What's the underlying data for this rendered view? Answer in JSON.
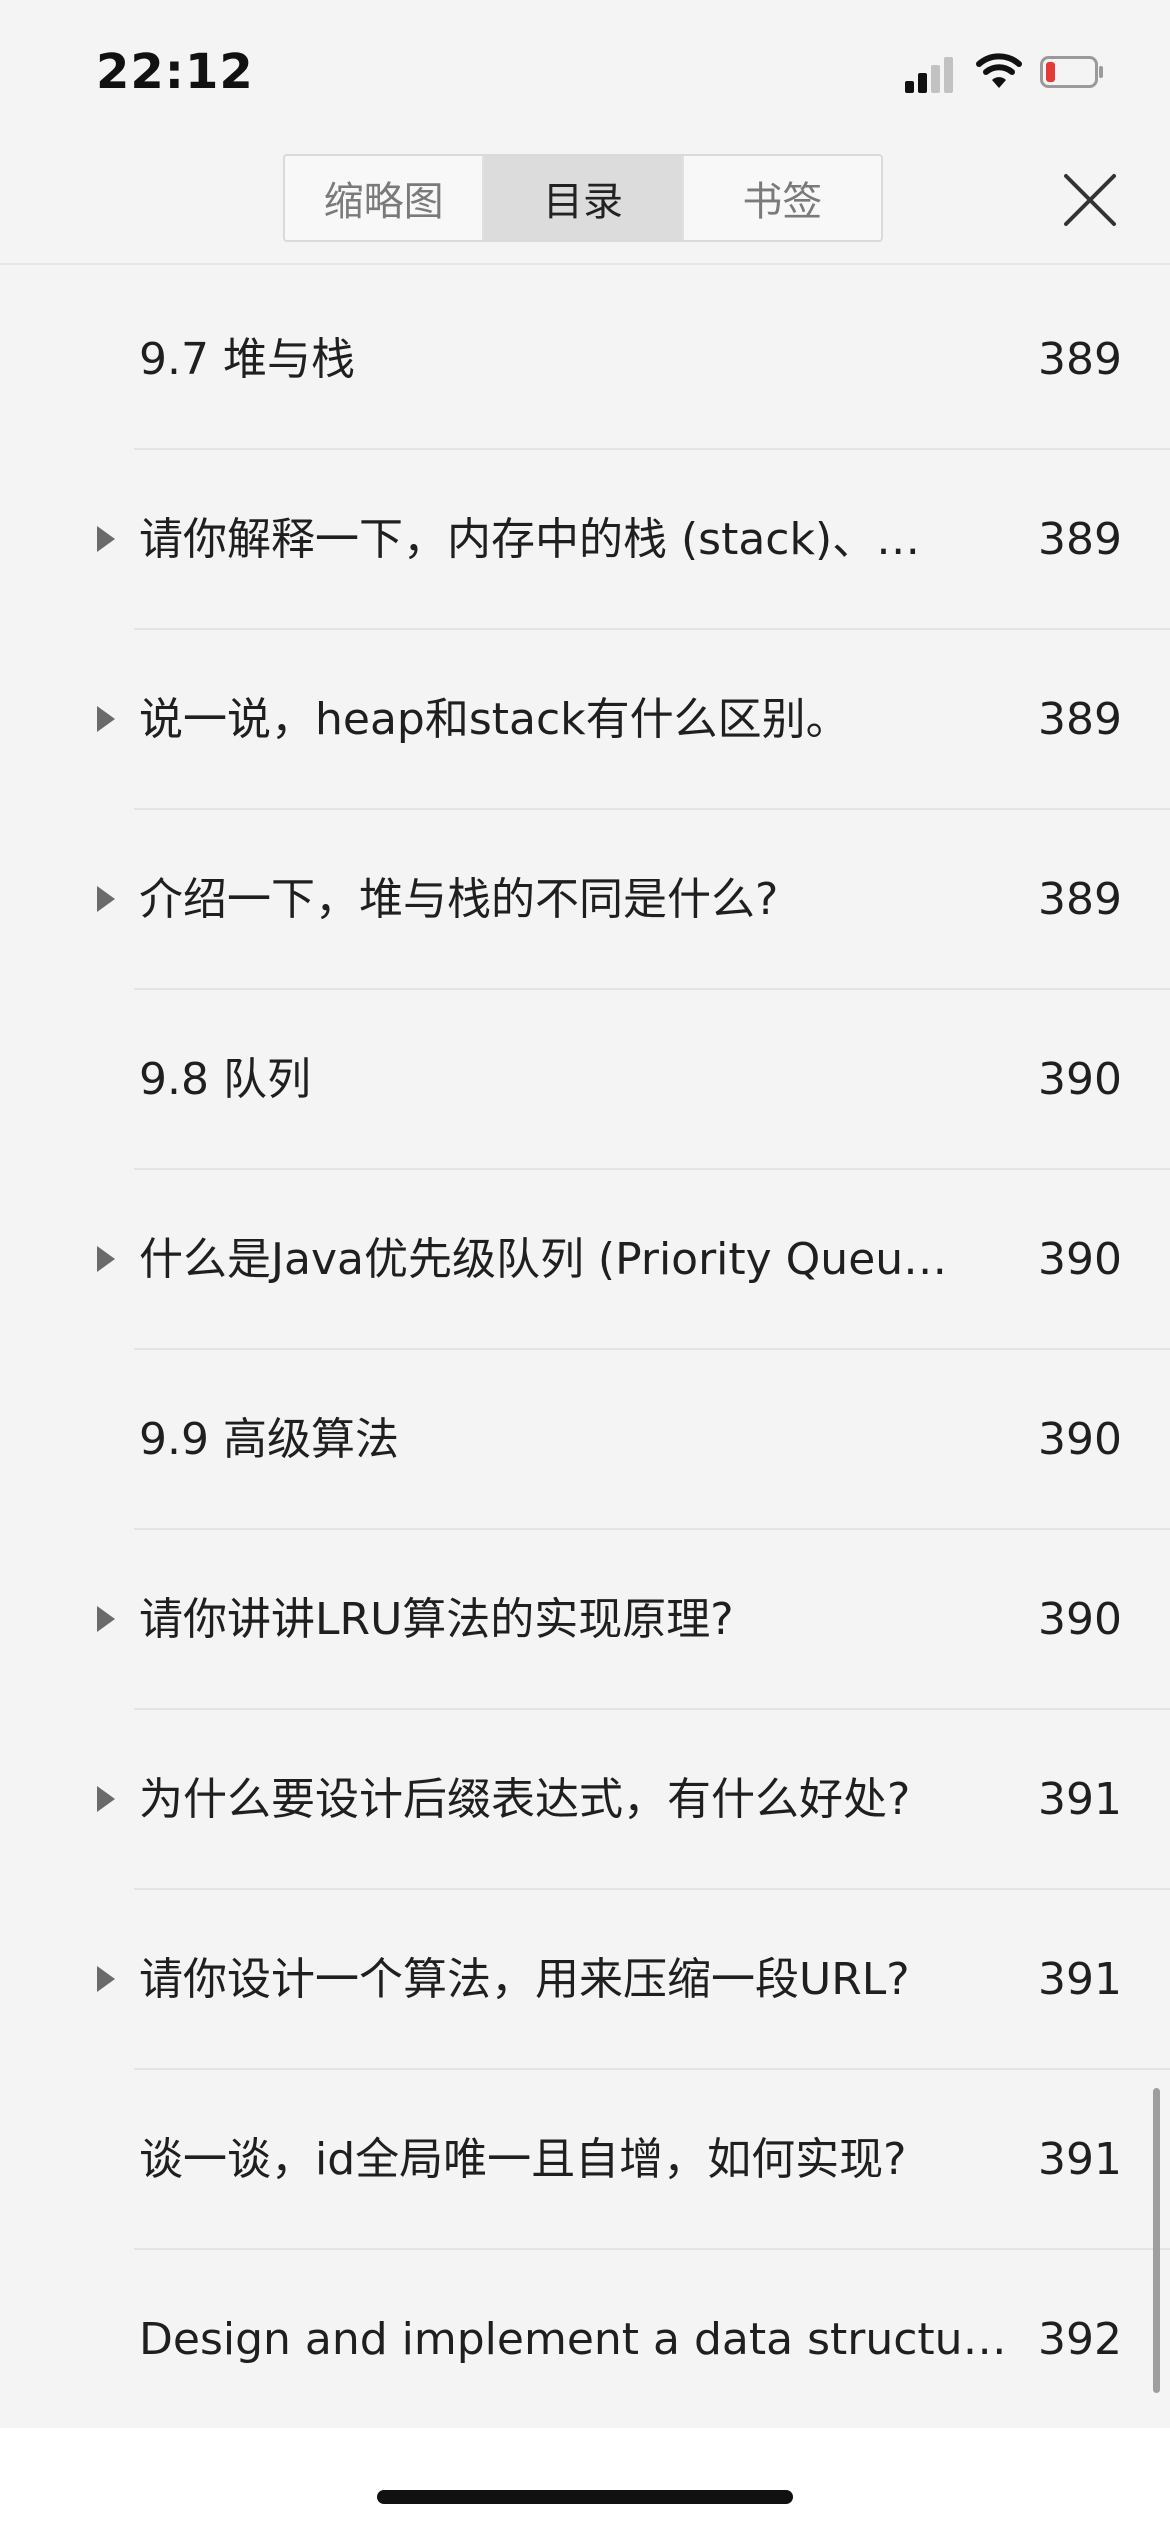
{
  "status_bar": {
    "time": "22:12"
  },
  "tabs": [
    {
      "label": "缩略图",
      "active": false
    },
    {
      "label": "目录",
      "active": true
    },
    {
      "label": "书签",
      "active": false
    }
  ],
  "toc": [
    {
      "title": "9.7 堆与栈",
      "page": "389",
      "expandable": false
    },
    {
      "title": "请你解释一下，内存中的栈 (stack)、…",
      "page": "389",
      "expandable": true
    },
    {
      "title": "说一说，heap和stack有什么区别。",
      "page": "389",
      "expandable": true
    },
    {
      "title": "介绍一下，堆与栈的不同是什么?",
      "page": "389",
      "expandable": true
    },
    {
      "title": "9.8 队列",
      "page": "390",
      "expandable": false
    },
    {
      "title": "什么是Java优先级队列 (Priority Queu…",
      "page": "390",
      "expandable": true
    },
    {
      "title": "9.9  高级算法",
      "page": "390",
      "expandable": false
    },
    {
      "title": "请你讲讲LRU算法的实现原理?",
      "page": "390",
      "expandable": true
    },
    {
      "title": "为什么要设计后缀表达式，有什么好处?",
      "page": "391",
      "expandable": true
    },
    {
      "title": "请你设计一个算法，用来压缩一段URL?",
      "page": "391",
      "expandable": true
    },
    {
      "title": "谈一谈，id全局唯一且自增，如何实现?",
      "page": "391",
      "expandable": false
    },
    {
      "title": "Design and implement a data structure…",
      "page": "392",
      "expandable": false
    }
  ],
  "icons": {
    "close": "close-icon",
    "signal": "signal-icon",
    "wifi": "wifi-icon",
    "battery": "battery-low-icon",
    "expand": "triangle-right-icon"
  },
  "colors": {
    "battery_low": "#e53935",
    "active_tab_bg": "#dcdcdc"
  }
}
